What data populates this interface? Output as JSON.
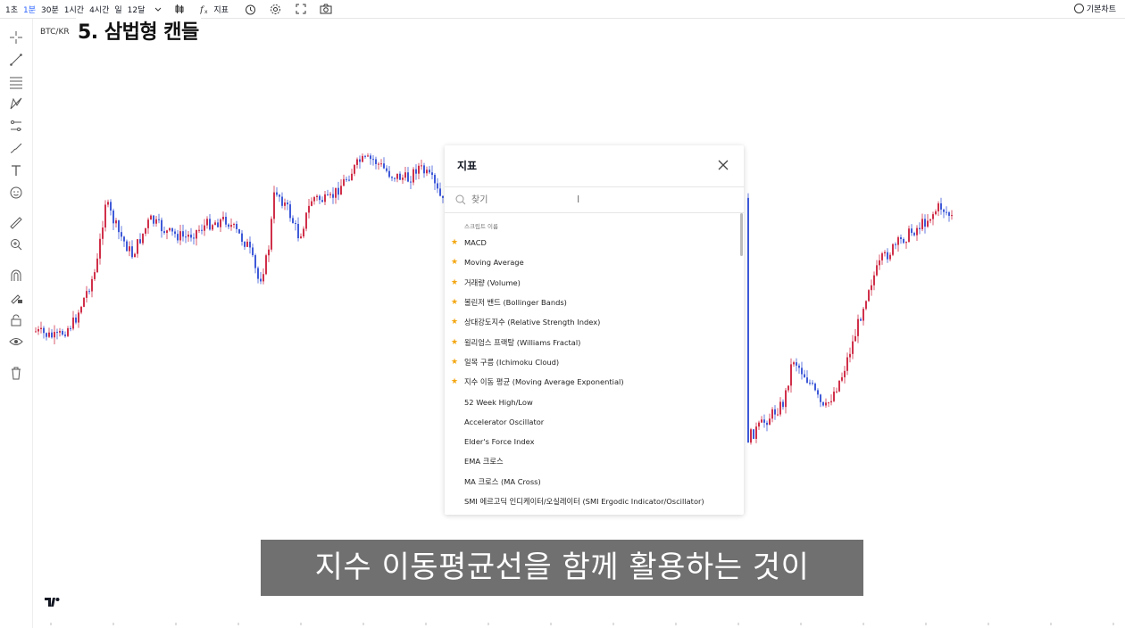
{
  "toolbar": {
    "timeframes": [
      "1초",
      "1분",
      "30분",
      "1시간",
      "4시간",
      "일",
      "12달"
    ],
    "active_timeframe": "1분",
    "indicators_label": "지표",
    "basic_chart_label": "기본차트"
  },
  "chart": {
    "symbol": "BTC/KR",
    "title_overlay": "5. 삼법형 캔들",
    "up_color": "#d0304a",
    "down_color": "#3f5ad8"
  },
  "dialog": {
    "title": "지표",
    "search_placeholder": "찾기",
    "section_label": "스크립트 이름",
    "favorites": [
      "MACD",
      "Moving Average",
      "거래량 (Volume)",
      "볼린저 밴드 (Bollinger Bands)",
      "상대강도지수 (Relative Strength Index)",
      "윌리엄스 프랙탈 (Williams Fractal)",
      "일목 구름 (Ichimoku Cloud)",
      "지수 이동 평균 (Moving Average Exponential)"
    ],
    "others": [
      "52 Week High/Low",
      "Accelerator Oscillator",
      "Elder's Force Index",
      "EMA 크로스",
      "MA 크로스 (MA Cross)",
      "SMI 에르고딕 인디케이터/오실레이터 (SMI Ergodic Indicator/Oscillator)"
    ]
  },
  "caption": "지수 이동평균선을 함께 활용하는 것이",
  "icons": [
    "candle-icon",
    "indicators-icon",
    "alert-icon",
    "settings-icon",
    "fullscreen-icon",
    "camera-icon",
    "crosshair-icon",
    "trendline-icon",
    "fib-icon",
    "pattern-icon",
    "prediction-icon",
    "brush-icon",
    "text-icon",
    "emoji-icon",
    "ruler-icon",
    "zoom-icon",
    "magnet-icon",
    "lock-drawing-icon",
    "lock-icon",
    "eye-icon",
    "trash-icon",
    "close-icon",
    "search-icon",
    "star-icon"
  ]
}
